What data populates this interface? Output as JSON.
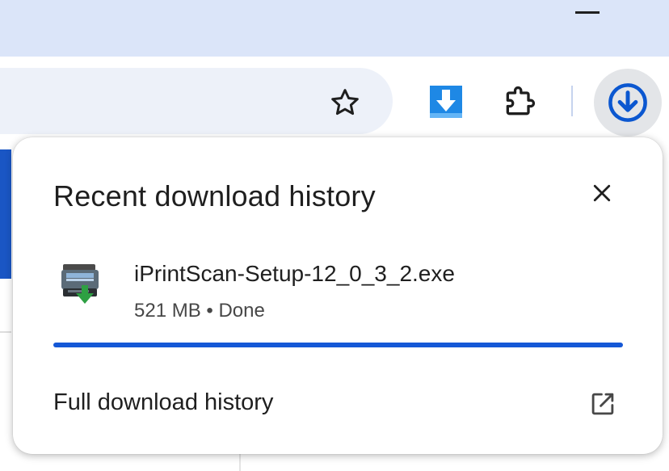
{
  "window": {
    "controls": {
      "minimize_icon": "minimize-icon"
    }
  },
  "toolbar": {
    "bookmark_icon": "star-icon",
    "extension_download_icon": "blue-download-arrow-icon",
    "extensions_icon": "puzzle-piece-icon",
    "downloads_icon": "download-circle-icon"
  },
  "downloads_panel": {
    "title": "Recent download history",
    "close_icon": "close-icon",
    "items": [
      {
        "file_name": "iPrintScan-Setup-12_0_3_2.exe",
        "meta": "521 MB • Done",
        "icon": "printer-scanner-installer-icon",
        "progress": 1.0
      }
    ],
    "footer_label": "Full download history",
    "footer_icon": "open-in-new-icon"
  },
  "colors": {
    "titlebar": "#dbe5f9",
    "omnibox": "#edf1f9",
    "accent": "#1558d6",
    "download_button_bg": "#e3e5e8",
    "download_button_icon": "#0b57d0"
  }
}
